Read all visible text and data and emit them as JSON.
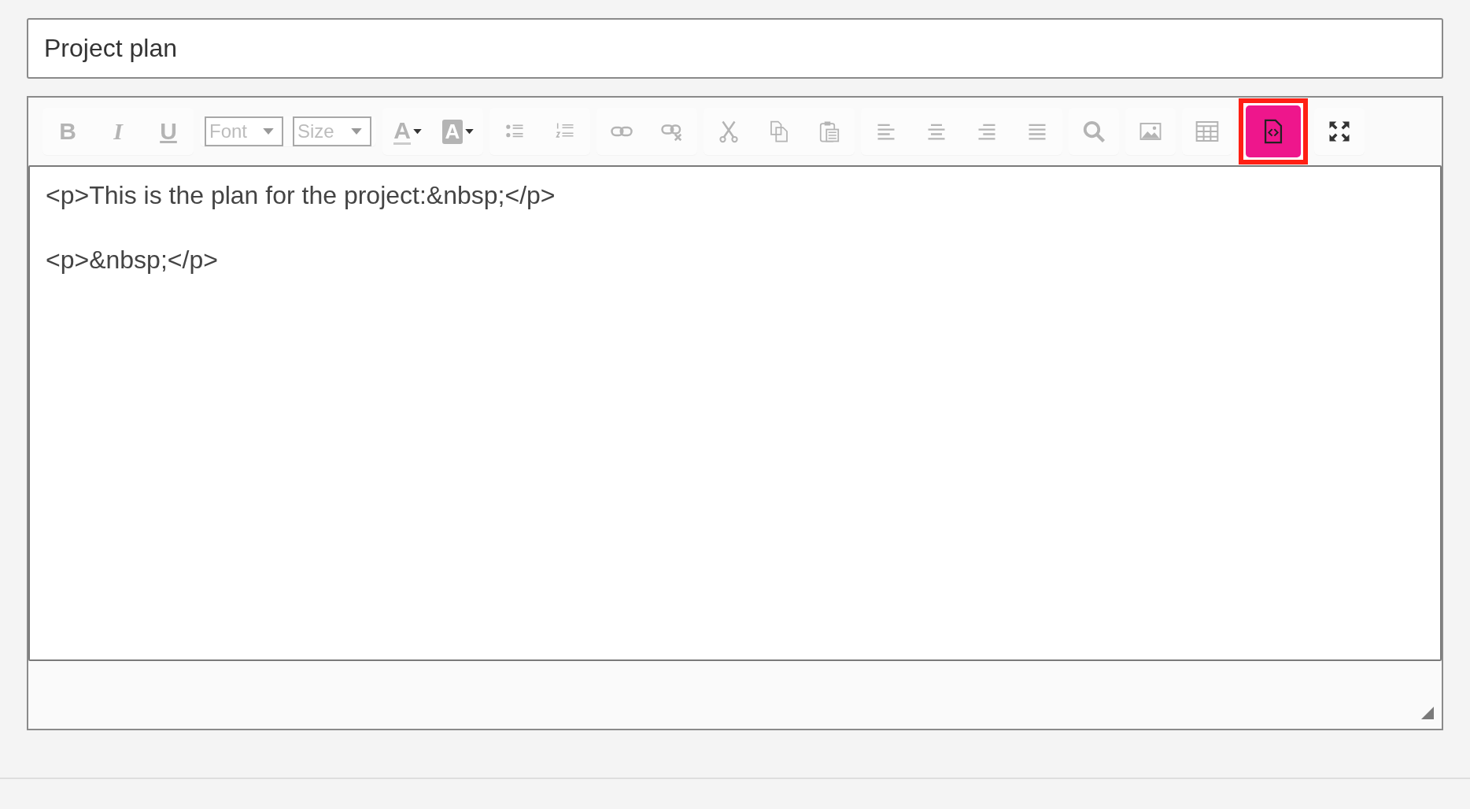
{
  "title_field": {
    "value": "Project plan"
  },
  "toolbar": [
    {
      "items": [
        {
          "kind": "bold",
          "label": "B",
          "disabled": true
        },
        {
          "kind": "italic",
          "label": "I",
          "disabled": true
        },
        {
          "kind": "underline",
          "label": "U",
          "disabled": true
        }
      ]
    },
    {
      "items": [
        {
          "kind": "select",
          "label": "Font",
          "disabled": true
        },
        {
          "kind": "select",
          "label": "Size",
          "disabled": true
        }
      ]
    },
    {
      "items": [
        {
          "kind": "textcolor",
          "label": "A",
          "disabled": true
        },
        {
          "kind": "bgcolor",
          "label": "A",
          "disabled": true
        }
      ]
    },
    {
      "items": [
        {
          "kind": "bullets",
          "disabled": true
        },
        {
          "kind": "numbers",
          "disabled": true
        }
      ]
    },
    {
      "items": [
        {
          "kind": "link",
          "disabled": true
        },
        {
          "kind": "unlink",
          "disabled": true
        }
      ]
    },
    {
      "items": [
        {
          "kind": "cut",
          "disabled": true
        },
        {
          "kind": "copy",
          "disabled": true
        },
        {
          "kind": "paste",
          "disabled": true
        }
      ]
    },
    {
      "items": [
        {
          "kind": "alignleft",
          "disabled": true
        },
        {
          "kind": "aligncenter",
          "disabled": true
        },
        {
          "kind": "alignright",
          "disabled": true
        },
        {
          "kind": "justify",
          "disabled": true
        }
      ]
    },
    {
      "items": [
        {
          "kind": "find",
          "disabled": true
        }
      ]
    },
    {
      "items": [
        {
          "kind": "image",
          "disabled": true
        }
      ]
    },
    {
      "items": [
        {
          "kind": "table",
          "disabled": true
        }
      ]
    },
    {
      "items": [
        {
          "kind": "source",
          "disabled": false,
          "selected": true
        }
      ]
    },
    {
      "items": [
        {
          "kind": "maximize",
          "disabled": false,
          "selected": false
        }
      ]
    }
  ],
  "source_lines": [
    "<p>This is the plan for the project:&nbsp;</p>",
    "<p>&nbsp;</p>"
  ]
}
